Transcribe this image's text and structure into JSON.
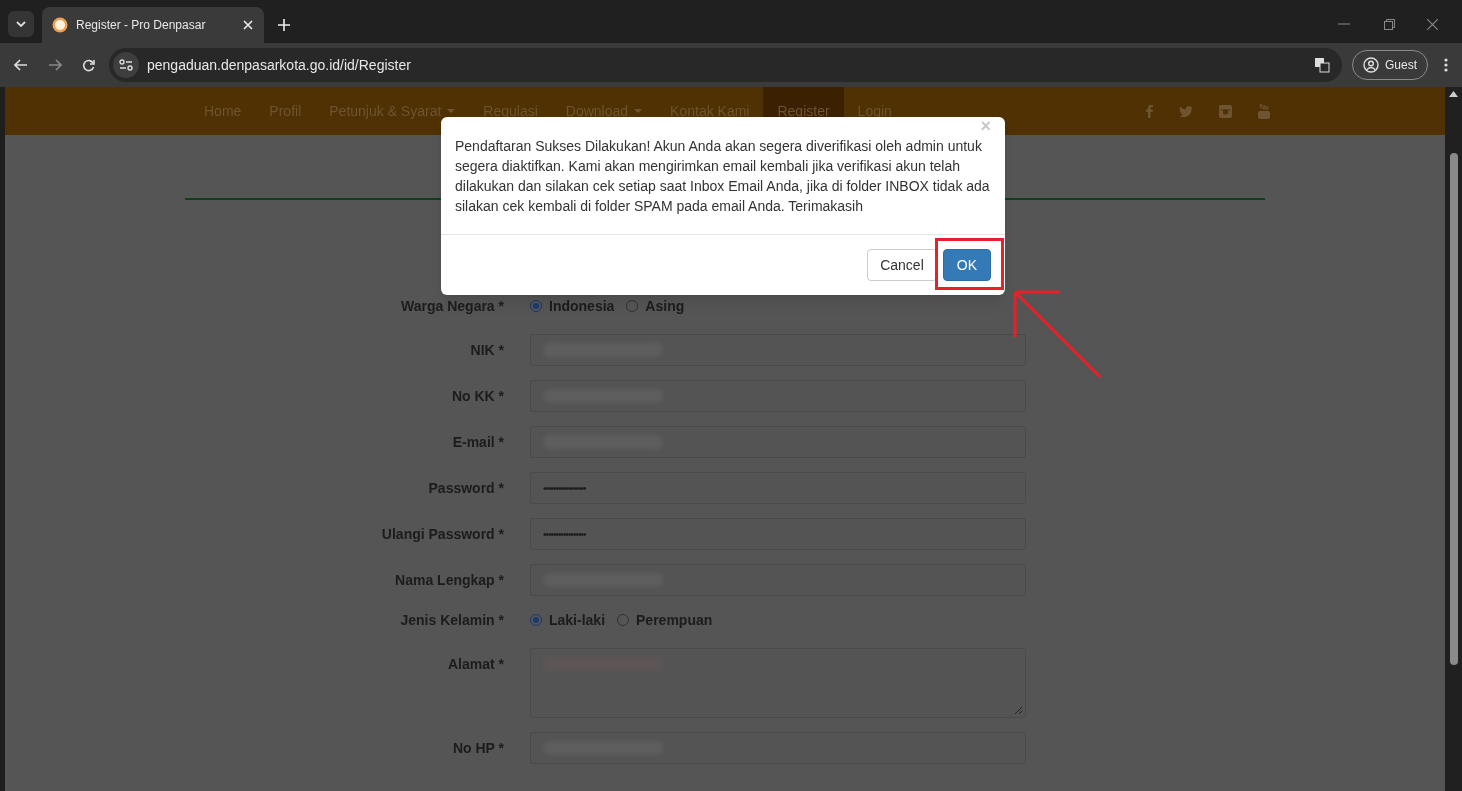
{
  "browser": {
    "tab_title": "Register - Pro Denpasar",
    "url": "pengaduan.denpasarkota.go.id/id/Register",
    "profile": "Guest"
  },
  "nav": {
    "items": [
      {
        "label": "Home",
        "dropdown": false,
        "selected": false
      },
      {
        "label": "Profil",
        "dropdown": false,
        "selected": false
      },
      {
        "label": "Petunjuk & Syarat",
        "dropdown": true,
        "selected": false
      },
      {
        "label": "Regulasi",
        "dropdown": false,
        "selected": false
      },
      {
        "label": "Download",
        "dropdown": true,
        "selected": false
      },
      {
        "label": "Kontak Kami",
        "dropdown": false,
        "selected": false
      },
      {
        "label": "Register",
        "dropdown": false,
        "selected": true
      },
      {
        "label": "Login",
        "dropdown": false,
        "selected": false
      }
    ]
  },
  "form": {
    "rows": [
      {
        "kind": "radio",
        "label": "Warga Negara *",
        "options": [
          {
            "label": "Indonesia",
            "selected": true
          },
          {
            "label": "Asing",
            "selected": false
          }
        ]
      },
      {
        "kind": "blurred",
        "label": "NIK *"
      },
      {
        "kind": "blurred",
        "label": "No KK *"
      },
      {
        "kind": "blurred",
        "label": "E-mail *"
      },
      {
        "kind": "password",
        "label": "Password *",
        "value": "•••••••••••••••••"
      },
      {
        "kind": "password",
        "label": "Ulangi Password *",
        "value": "•••••••••••••••••"
      },
      {
        "kind": "blurred",
        "label": "Nama Lengkap *"
      },
      {
        "kind": "radio",
        "label": "Jenis Kelamin *",
        "options": [
          {
            "label": "Laki-laki",
            "selected": true
          },
          {
            "label": "Perempuan",
            "selected": false
          }
        ]
      },
      {
        "kind": "textarea",
        "label": "Alamat *"
      },
      {
        "kind": "blurred",
        "label": "No HP *"
      }
    ]
  },
  "dialog": {
    "close": "×",
    "message": "Pendaftaran Sukses Dilakukan! Akun Anda akan segera diverifikasi oleh admin untuk segera diaktifkan. Kami akan mengirimkan email kembali jika verifikasi akun telah dilakukan dan silakan cek setiap saat Inbox Email Anda, jika di folder INBOX tidak ada silakan cek kembali di folder SPAM pada email Anda. Terimakasih",
    "buttons": [
      {
        "label": "Cancel",
        "kind": "default"
      },
      {
        "label": "OK",
        "kind": "primary"
      }
    ]
  }
}
